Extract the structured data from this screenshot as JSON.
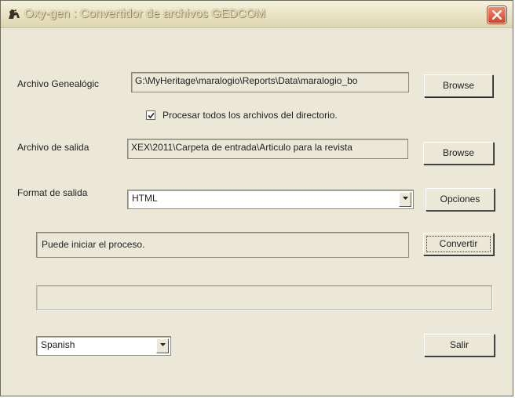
{
  "window": {
    "title": "Oxy-gen : Convertidor de archivos GEDCOM",
    "icon": "horse-app-icon"
  },
  "form": {
    "source_label": "Archivo Genealógic",
    "source_path": "G:\\MyHeritage\\maralogio\\Reports\\Data\\maralogio_bo",
    "browse_label": "Browse",
    "process_all_label": "Procesar todos los archivos del directorio.",
    "process_all_checked": true,
    "output_label": "Archivo de salida",
    "output_path": "XEX\\2011\\Carpeta de entrada\\Articulo para la revista",
    "browse2_label": "Browse",
    "format_label": "Format de salida",
    "format_value": "HTML",
    "options_label": "Opciones",
    "status_text": "Puede iniciar el proceso.",
    "convert_label": "Convertir",
    "progress": 0,
    "language_value": "Spanish",
    "exit_label": "Salir"
  },
  "colors": {
    "window_bg": "#ebe8d8",
    "close_red": "#d4442a"
  }
}
